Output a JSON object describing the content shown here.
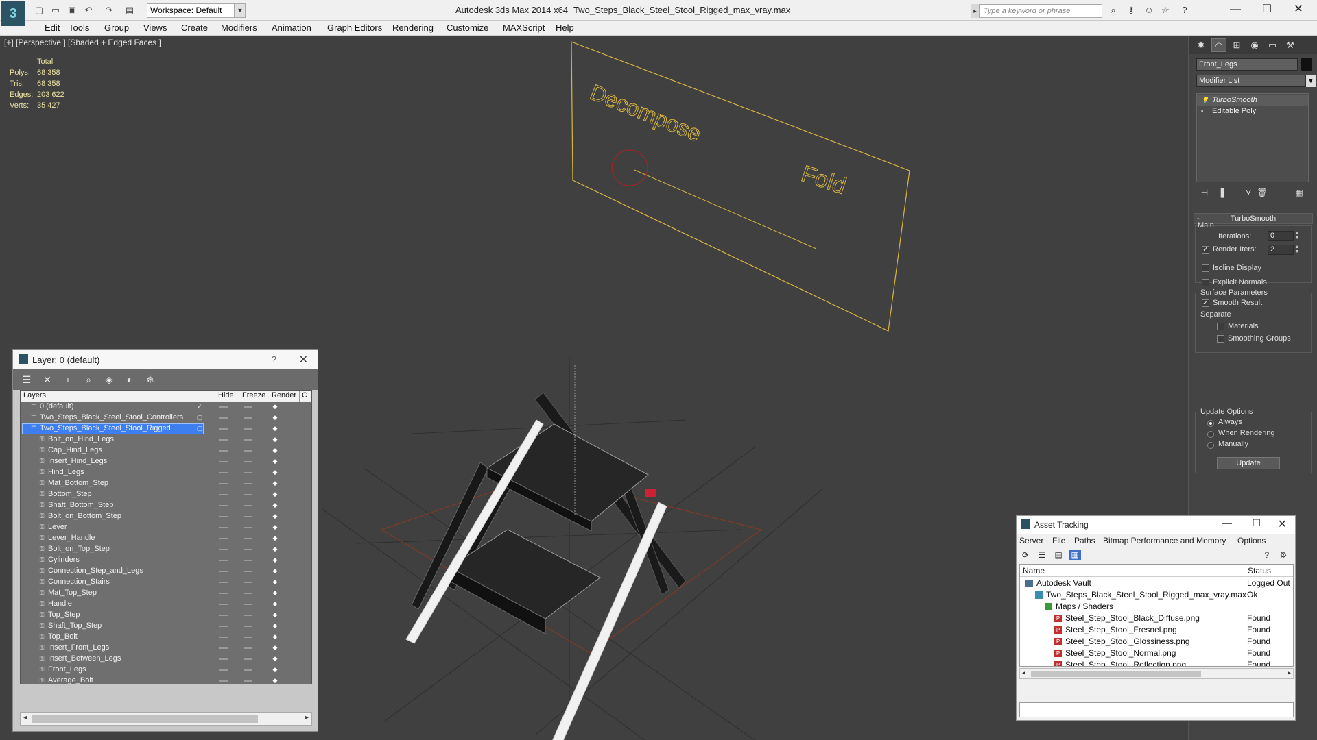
{
  "titlebar": {
    "workspace": "Workspace: Default",
    "app_title": "Autodesk 3ds Max  2014 x64",
    "file_title": "Two_Steps_Black_Steel_Stool_Rigged_max_vray.max",
    "search_placeholder": "Type a keyword or phrase"
  },
  "menu": [
    "Edit",
    "Tools",
    "Group",
    "Views",
    "Create",
    "Modifiers",
    "Animation",
    "Graph Editors",
    "Rendering",
    "Customize",
    "MAXScript",
    "Help"
  ],
  "viewport": {
    "label": "[+] [Perspective ] [Shaded + Edged Faces ]",
    "stats": {
      "header": "Total",
      "rows": [
        {
          "label": "Polys:",
          "value": "68 358"
        },
        {
          "label": "Tris:",
          "value": "68 358"
        },
        {
          "label": "Edges:",
          "value": "203 622"
        },
        {
          "label": "Verts:",
          "value": "35 427"
        }
      ]
    },
    "annotations": {
      "decompose": "Decompose",
      "fold": "Fold"
    },
    "colors": {
      "background": "#404040",
      "stats_text": "#e8e0a0",
      "helper_shape": "#d7b640"
    }
  },
  "layer_dialog": {
    "title": "Layer: 0 (default)",
    "columns": [
      "Layers",
      "Hide",
      "Freeze",
      "Render",
      "C"
    ],
    "layers": [
      {
        "name": "0 (default)",
        "indent": 0,
        "current": true,
        "selected": false
      },
      {
        "name": "Two_Steps_Black_Steel_Stool_Controllers",
        "indent": 0,
        "current": false,
        "selected": false
      },
      {
        "name": "Two_Steps_Black_Steel_Stool_Rigged",
        "indent": 0,
        "current": false,
        "selected": true
      },
      {
        "name": "Bolt_on_Hind_Legs",
        "indent": 1
      },
      {
        "name": "Cap_Hind_Legs",
        "indent": 1
      },
      {
        "name": "Insert_Hind_Legs",
        "indent": 1
      },
      {
        "name": "Hind_Legs",
        "indent": 1
      },
      {
        "name": "Mat_Bottom_Step",
        "indent": 1
      },
      {
        "name": "Bottom_Step",
        "indent": 1
      },
      {
        "name": "Shaft_Bottom_Step",
        "indent": 1
      },
      {
        "name": "Bolt_on_Bottom_Step",
        "indent": 1
      },
      {
        "name": "Lever",
        "indent": 1
      },
      {
        "name": "Lever_Handle",
        "indent": 1
      },
      {
        "name": "Bolt_on_Top_Step",
        "indent": 1
      },
      {
        "name": "Cylinders",
        "indent": 1
      },
      {
        "name": "Connection_Step_and_Legs",
        "indent": 1
      },
      {
        "name": "Connection_Stairs",
        "indent": 1
      },
      {
        "name": "Mat_Top_Step",
        "indent": 1
      },
      {
        "name": "Handle",
        "indent": 1
      },
      {
        "name": "Top_Step",
        "indent": 1
      },
      {
        "name": "Shaft_Top_Step",
        "indent": 1
      },
      {
        "name": "Top_Bolt",
        "indent": 1
      },
      {
        "name": "Insert_Front_Legs",
        "indent": 1
      },
      {
        "name": "Insert_Between_Legs",
        "indent": 1
      },
      {
        "name": "Front_Legs",
        "indent": 1
      },
      {
        "name": "Average_Bolt",
        "indent": 1
      }
    ]
  },
  "command_panel": {
    "object_name": "Front_Legs",
    "modifier_list": "Modifier List",
    "stack": [
      "TurboSmooth",
      "Editable Poly"
    ],
    "rollout_title": "TurboSmooth",
    "main_group": "Main",
    "iterations_label": "Iterations:",
    "iterations_value": "0",
    "render_iters_label": "Render Iters:",
    "render_iters_value": "2",
    "isoline_label": "Isoline Display",
    "explicit_normals_label": "Explicit Normals",
    "surface_group": "Surface Parameters",
    "smooth_result_label": "Smooth Result",
    "separate_label": "Separate",
    "materials_label": "Materials",
    "smoothing_groups_label": "Smoothing Groups",
    "update_group": "Update Options",
    "always_label": "Always",
    "when_rendering_label": "When Rendering",
    "manually_label": "Manually",
    "update_button": "Update"
  },
  "asset_tracking": {
    "title": "Asset Tracking",
    "menu": [
      "Server",
      "File",
      "Paths",
      "Bitmap Performance and Memory",
      "Options"
    ],
    "columns": {
      "name": "Name",
      "status": "Status"
    },
    "rows": [
      {
        "name": "Autodesk Vault",
        "status": "Logged Out",
        "indent": 0,
        "icon": "vault"
      },
      {
        "name": "Two_Steps_Black_Steel_Stool_Rigged_max_vray.max",
        "status": "Ok",
        "indent": 1,
        "icon": "max-file"
      },
      {
        "name": "Maps / Shaders",
        "status": "",
        "indent": 2,
        "icon": "maps"
      },
      {
        "name": "Steel_Step_Stool_Black_Diffuse.png",
        "status": "Found",
        "indent": 3,
        "icon": "png"
      },
      {
        "name": "Steel_Step_Stool_Fresnel.png",
        "status": "Found",
        "indent": 3,
        "icon": "png"
      },
      {
        "name": "Steel_Step_Stool_Glossiness.png",
        "status": "Found",
        "indent": 3,
        "icon": "png"
      },
      {
        "name": "Steel_Step_Stool_Normal.png",
        "status": "Found",
        "indent": 3,
        "icon": "png"
      },
      {
        "name": "Steel_Step_Stool_Reflection.png",
        "status": "Found",
        "indent": 3,
        "icon": "png"
      }
    ]
  }
}
